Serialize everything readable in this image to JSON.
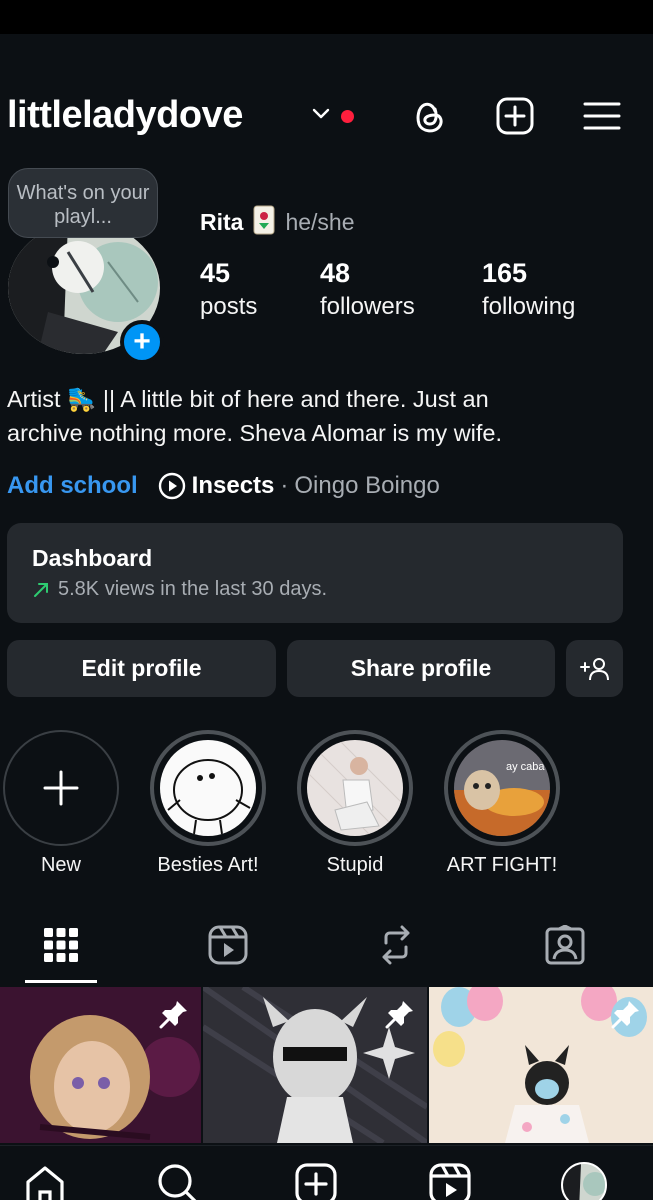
{
  "header": {
    "username": "littleladydove"
  },
  "profile": {
    "note": "What's on your playl...",
    "name": "Rita",
    "pronouns": "he/she",
    "stats": [
      {
        "value": "45",
        "label": "posts"
      },
      {
        "value": "48",
        "label": "followers"
      },
      {
        "value": "165",
        "label": "following"
      }
    ],
    "bio_line1": "Artist 🛼 || A little bit of here and there. Just an",
    "bio_line2": "archive nothing more. Sheva Alomar is my wife.",
    "add_school": "Add school",
    "music_song": "Insects",
    "music_separator": "·",
    "music_artist": "Oingo Boingo"
  },
  "dashboard": {
    "title": "Dashboard",
    "subtitle": "5.8K views in the last 30 days."
  },
  "buttons": {
    "edit": "Edit profile",
    "share": "Share profile"
  },
  "highlights": [
    {
      "label": "New"
    },
    {
      "label": "Besties Art!"
    },
    {
      "label": "Stupid"
    },
    {
      "label": "ART FIGHT!"
    }
  ],
  "highlight_overlay_text": "ay caba",
  "colors": {
    "background": "#0c1014",
    "accent_blue": "#0095f6",
    "link_blue": "#3897f0",
    "notification_red": "#ff1f3d",
    "card": "#25292e",
    "trend_green": "#2ecc71"
  }
}
